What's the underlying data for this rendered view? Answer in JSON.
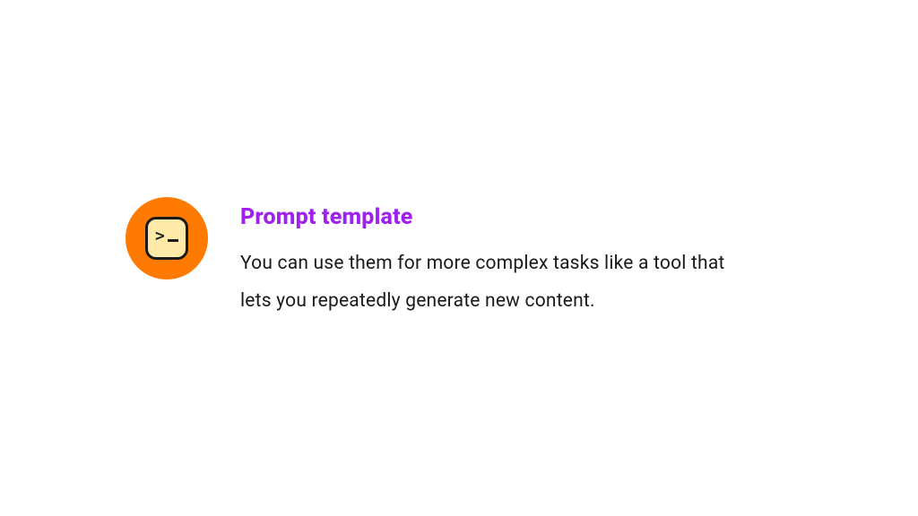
{
  "card": {
    "heading": "Prompt template",
    "description": "You can use them for more complex tasks like a tool that lets you repeatedly generate new content.",
    "icon_name": "terminal"
  },
  "colors": {
    "accent_orange": "#FF7A00",
    "heading_purple": "#A020F0",
    "icon_fill": "#FFE9A8",
    "text": "#1a1a1a"
  }
}
